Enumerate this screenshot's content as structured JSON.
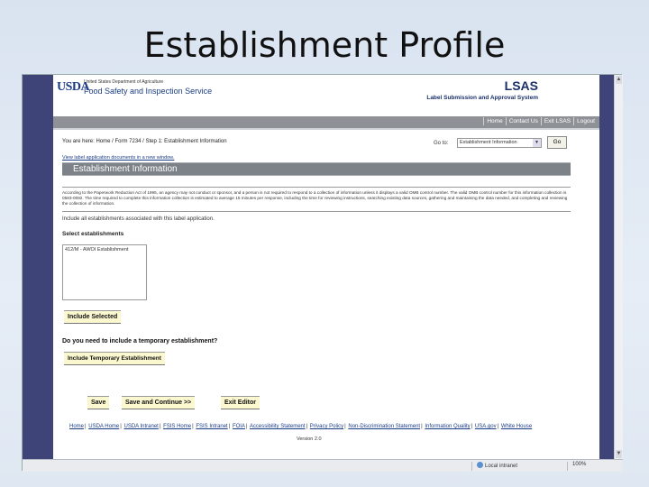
{
  "slide": {
    "title": "Establishment Profile"
  },
  "header": {
    "logo": "USDA",
    "agency_sub": "United States Department of Agriculture",
    "agency": "Food Safety and Inspection Service",
    "app_name": "LSAS",
    "app_subtitle": "Label Submission and Approval System"
  },
  "nav": {
    "items": [
      "Home",
      "Contact Us",
      "Exit LSAS",
      "Logout"
    ]
  },
  "breadcrumb": "You are here: Home / Form 7234 / Step 1: Establishment Information",
  "goto": {
    "label": "Go to:",
    "selected": "Establishment Information",
    "button": "Go"
  },
  "view_link": "View label application documents in a new window.",
  "section_title": "Establishment Information",
  "paperwork_text": "According to the Paperwork Reduction Act of 1995, an agency may not conduct or sponsor, and a person is not required to respond to a collection of information unless it displays a valid OMB control number. The valid OMB control number for this information collection is 0583-0092. The time required to complete this information collection is estimated to average 15 minutes per response, including the time for reviewing instructions, searching existing data sources, gathering and maintaining the data needed, and completing and reviewing the collection of information.",
  "include_text": "Include all establishments associated with this label application.",
  "select_label": "Select establishments",
  "establishments": [
    "412/M - AWOI Establishment"
  ],
  "buttons": {
    "include_selected": "Include Selected",
    "include_temp": "Include Temporary Establishment",
    "save": "Save",
    "save_continue": "Save and Continue >>",
    "exit_editor": "Exit Editor"
  },
  "temp_question": "Do you need to include a temporary establishment?",
  "footer": {
    "links": [
      "Home",
      "USDA Home",
      "USDA Intranet",
      "FSIS Home",
      "FSIS Intranet",
      "FOIA",
      "Accessibility Statement",
      "Privacy Policy",
      "Non-Discrimination Statement",
      "Information Quality",
      "USA.gov",
      "White House"
    ],
    "version": "Version 2.0"
  },
  "statusbar": {
    "zone": "Local intranet",
    "zoom": "100%"
  },
  "colors": {
    "sidebar": "#3f4478",
    "navbar": "#8e9196",
    "section_bar": "#7d8288",
    "button_bg": "#fbf8d0",
    "brand": "#1a3c84"
  }
}
